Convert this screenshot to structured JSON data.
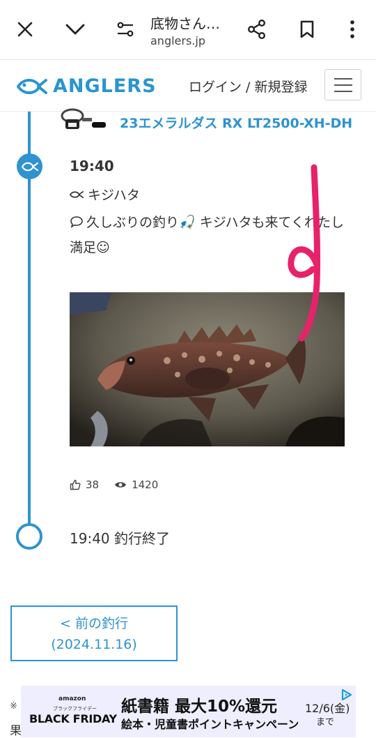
{
  "browser": {
    "title": "底物さん…",
    "url": "anglers.jp",
    "icons": [
      "close-icon",
      "chevron-down-icon",
      "site-settings-icon",
      "share-icon",
      "bookmark-icon",
      "more-vert-icon"
    ]
  },
  "site": {
    "logo_text": "ANGLERS",
    "login_label": "ログイン / 新規登録",
    "brand_color": "#2f93cf"
  },
  "timeline": {
    "tackle_name": "23エメラルダス RX LT2500-XH-DH",
    "entry": {
      "time": "19:40",
      "species": "キジハタ",
      "comment": "久しぶりの釣り🎣 キジハタも来てくれたし満足☺",
      "likes": "38",
      "views": "1420"
    },
    "end": {
      "text": "19:40 釣行終了"
    }
  },
  "prev_trip": {
    "label": "< 前の釣行",
    "date": "(2024.11.16)"
  },
  "fragments": {
    "note": "※",
    "result": "果"
  },
  "ad": {
    "amazon": "amazon",
    "bf_sub": "ブラックフライデー",
    "bf": "BLACK FRIDAY",
    "headline": "紙書籍 最大10%還元",
    "sub": "絵本・児童書ポイントキャンペーン",
    "date": "12/6(金)",
    "until": "まで"
  }
}
